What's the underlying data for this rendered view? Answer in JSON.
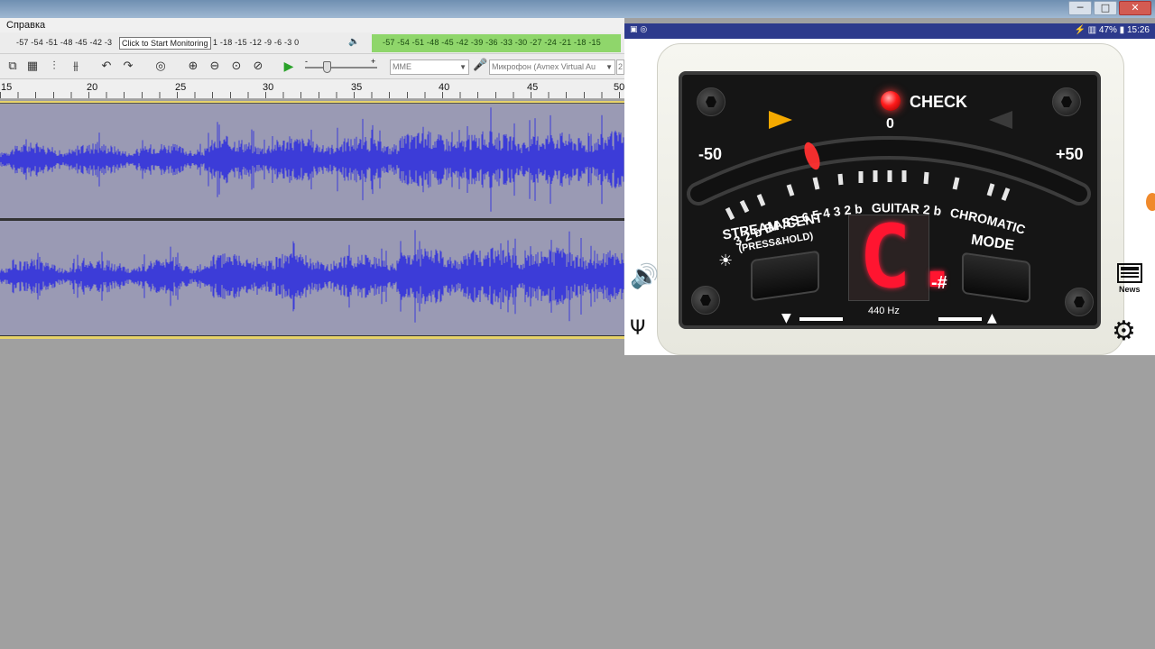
{
  "window": {
    "controls": {
      "minimize": "─",
      "maximize": "□",
      "close": "✕"
    }
  },
  "audacity": {
    "menu_item": "Справка",
    "rec_meter_scale": "-57 -54 -51 -48 -45 -42 -3",
    "rec_meter_scale_tail": "1 -18 -15 -12  -9  -6  -3  0",
    "tooltip": "Click to Start Monitoring",
    "play_meter_scale": "-57 -54 -51 -48 -45 -42 -39 -36 -33 -30 -27 -24 -21 -18 -15",
    "host_combo": "MME",
    "mic_combo": "Микрофон (Avnex Virtual Au",
    "channels_combo": "2",
    "slider_minus": "-",
    "slider_plus": "+",
    "ruler_labels": [
      "15",
      "20",
      "25",
      "30",
      "35",
      "40",
      "45",
      "50"
    ],
    "icons": {
      "speaker": "speaker-icon",
      "mic": "microphone-icon",
      "play": "play-icon"
    },
    "colors": {
      "waveform": "#3c3cd8",
      "track_bg": "#9a9ab4",
      "meter_green": "#8fd66b"
    }
  },
  "tuner": {
    "status_left": "▣ ◎",
    "status_right": "⚡ ▥ 47% ▮ 15:26",
    "check_label": "CHECK",
    "zero_label": "0",
    "minus50": "-50",
    "plus50": "+50",
    "scale_text_left": "3 2 b BASS 6 5 4 3 2 b",
    "scale_text_guitar": "GUITAR 2 b",
    "scale_text_chromatic": "CHROMATIC",
    "stream_label": "STREAM /CENT",
    "press_hold_label": "(PRESS&HOLD)",
    "mode_label": "MODE",
    "display_note": "C.",
    "hz_label": "440 Hz",
    "sharp_label": "-#",
    "down_arrow": "▼",
    "up_arrow": "▲",
    "sun_icon": "☀",
    "news_label": "News",
    "colors": {
      "led": "#ff1a1a",
      "display": "#ff1530",
      "status_bar": "#2d3a8c",
      "arrow_active": "#f4a900"
    }
  }
}
